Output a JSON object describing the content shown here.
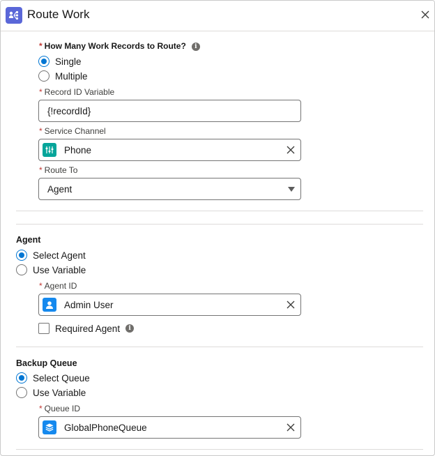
{
  "header": {
    "title": "Route Work",
    "app_icon": "route-work-icon",
    "close_icon": "close-icon",
    "accent_color": "#5a67d8"
  },
  "records": {
    "label": "How Many Work Records to Route?",
    "options": [
      "Single",
      "Multiple"
    ],
    "selected": "Single"
  },
  "record_id": {
    "label": "Record ID Variable",
    "value": "{!recordId}"
  },
  "service_channel": {
    "label": "Service Channel",
    "value": "Phone",
    "icon": "phone-channel-icon",
    "icon_color": "#06a59a"
  },
  "route_to": {
    "label": "Route To",
    "value": "Agent"
  },
  "agent": {
    "title": "Agent",
    "options": [
      "Select Agent",
      "Use Variable"
    ],
    "selected": "Select Agent",
    "id_label": "Agent ID",
    "id_value": "Admin User",
    "icon": "user-icon",
    "icon_color": "#1589ee",
    "required_label": "Required Agent",
    "required_checked": false
  },
  "backup_queue": {
    "title": "Backup Queue",
    "options": [
      "Select Queue",
      "Use Variable"
    ],
    "selected": "Select Queue",
    "id_label": "Queue ID",
    "id_value": "GlobalPhoneQueue",
    "icon": "queue-icon",
    "icon_color": "#1589ee"
  },
  "required_marker": "*"
}
